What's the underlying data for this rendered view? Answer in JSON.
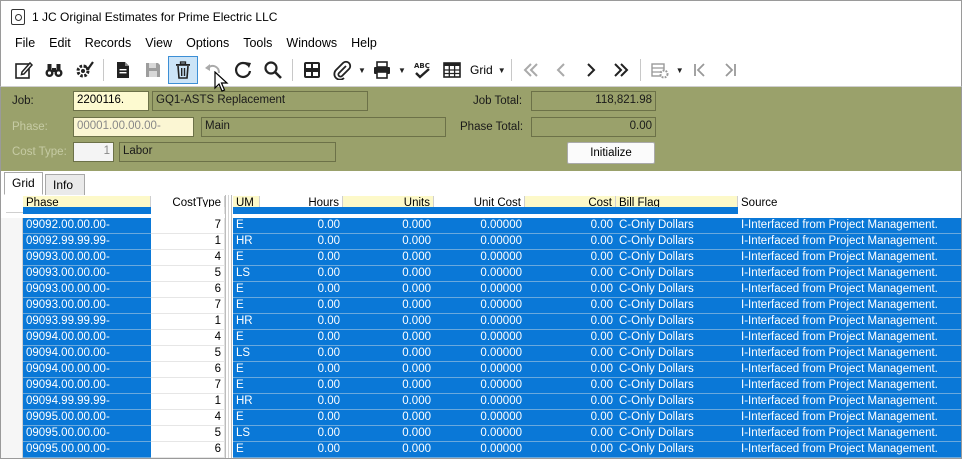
{
  "window": {
    "title": "1 JC Original Estimates for Prime Electric LLC"
  },
  "menu": [
    "File",
    "Edit",
    "Records",
    "View",
    "Options",
    "Tools",
    "Windows",
    "Help"
  ],
  "toolbar": {
    "grid_label": "Grid",
    "icons": [
      "edit-icon",
      "binoculars-icon",
      "settings-check-icon",
      "document-icon",
      "save-icon",
      "delete-icon",
      "undo-icon",
      "refresh-icon",
      "search-icon",
      "columns-icon",
      "attachment-icon",
      "print-icon",
      "spellcheck-icon",
      "grid-icon",
      "first-record-icon",
      "previous-record-icon",
      "next-record-icon",
      "last-record-icon",
      "settings-icon",
      "first-icon",
      "last-icon"
    ]
  },
  "header": {
    "job_label": "Job:",
    "job_value": "2200116.",
    "job_desc": "GQ1-ASTS Replacement",
    "phase_label": "Phase:",
    "phase_value": "00001.00.00.00-",
    "phase_desc": "Main",
    "costtype_label": "Cost Type:",
    "costtype_value": "1",
    "costtype_desc": "Labor",
    "job_total_label": "Job Total:",
    "job_total_value": "118,821.98",
    "phase_total_label": "Phase Total:",
    "phase_total_value": "0.00",
    "initialize_label": "Initialize"
  },
  "tabs": [
    "Grid",
    "Info"
  ],
  "grid": {
    "columns": {
      "phase": "Phase",
      "costtype": "CostType",
      "um": "UM",
      "hours": "Hours",
      "units": "Units",
      "unit_cost": "Unit Cost",
      "cost": "Cost",
      "bill_flag": "Bill Flag",
      "source": "Source"
    },
    "rows": [
      {
        "phase": "09092.00.00.00-",
        "costtype": "7",
        "um": "E",
        "hours": "0.00",
        "units": "0.000",
        "unit_cost": "0.00000",
        "cost": "0.00",
        "bill_flag": "C-Only Dollars",
        "source": "I-Interfaced from Project Management."
      },
      {
        "phase": "09092.99.99.99-",
        "costtype": "1",
        "um": "HR",
        "hours": "0.00",
        "units": "0.000",
        "unit_cost": "0.00000",
        "cost": "0.00",
        "bill_flag": "C-Only Dollars",
        "source": "I-Interfaced from Project Management."
      },
      {
        "phase": "09093.00.00.00-",
        "costtype": "4",
        "um": "E",
        "hours": "0.00",
        "units": "0.000",
        "unit_cost": "0.00000",
        "cost": "0.00",
        "bill_flag": "C-Only Dollars",
        "source": "I-Interfaced from Project Management."
      },
      {
        "phase": "09093.00.00.00-",
        "costtype": "5",
        "um": "LS",
        "hours": "0.00",
        "units": "0.000",
        "unit_cost": "0.00000",
        "cost": "0.00",
        "bill_flag": "C-Only Dollars",
        "source": "I-Interfaced from Project Management."
      },
      {
        "phase": "09093.00.00.00-",
        "costtype": "6",
        "um": "E",
        "hours": "0.00",
        "units": "0.000",
        "unit_cost": "0.00000",
        "cost": "0.00",
        "bill_flag": "C-Only Dollars",
        "source": "I-Interfaced from Project Management."
      },
      {
        "phase": "09093.00.00.00-",
        "costtype": "7",
        "um": "E",
        "hours": "0.00",
        "units": "0.000",
        "unit_cost": "0.00000",
        "cost": "0.00",
        "bill_flag": "C-Only Dollars",
        "source": "I-Interfaced from Project Management."
      },
      {
        "phase": "09093.99.99.99-",
        "costtype": "1",
        "um": "HR",
        "hours": "0.00",
        "units": "0.000",
        "unit_cost": "0.00000",
        "cost": "0.00",
        "bill_flag": "C-Only Dollars",
        "source": "I-Interfaced from Project Management."
      },
      {
        "phase": "09094.00.00.00-",
        "costtype": "4",
        "um": "E",
        "hours": "0.00",
        "units": "0.000",
        "unit_cost": "0.00000",
        "cost": "0.00",
        "bill_flag": "C-Only Dollars",
        "source": "I-Interfaced from Project Management."
      },
      {
        "phase": "09094.00.00.00-",
        "costtype": "5",
        "um": "LS",
        "hours": "0.00",
        "units": "0.000",
        "unit_cost": "0.00000",
        "cost": "0.00",
        "bill_flag": "C-Only Dollars",
        "source": "I-Interfaced from Project Management."
      },
      {
        "phase": "09094.00.00.00-",
        "costtype": "6",
        "um": "E",
        "hours": "0.00",
        "units": "0.000",
        "unit_cost": "0.00000",
        "cost": "0.00",
        "bill_flag": "C-Only Dollars",
        "source": "I-Interfaced from Project Management."
      },
      {
        "phase": "09094.00.00.00-",
        "costtype": "7",
        "um": "E",
        "hours": "0.00",
        "units": "0.000",
        "unit_cost": "0.00000",
        "cost": "0.00",
        "bill_flag": "C-Only Dollars",
        "source": "I-Interfaced from Project Management."
      },
      {
        "phase": "09094.99.99.99-",
        "costtype": "1",
        "um": "HR",
        "hours": "0.00",
        "units": "0.000",
        "unit_cost": "0.00000",
        "cost": "0.00",
        "bill_flag": "C-Only Dollars",
        "source": "I-Interfaced from Project Management."
      },
      {
        "phase": "09095.00.00.00-",
        "costtype": "4",
        "um": "E",
        "hours": "0.00",
        "units": "0.000",
        "unit_cost": "0.00000",
        "cost": "0.00",
        "bill_flag": "C-Only Dollars",
        "source": "I-Interfaced from Project Management."
      },
      {
        "phase": "09095.00.00.00-",
        "costtype": "5",
        "um": "LS",
        "hours": "0.00",
        "units": "0.000",
        "unit_cost": "0.00000",
        "cost": "0.00",
        "bill_flag": "C-Only Dollars",
        "source": "I-Interfaced from Project Management."
      },
      {
        "phase": "09095.00.00.00-",
        "costtype": "6",
        "um": "E",
        "hours": "0.00",
        "units": "0.000",
        "unit_cost": "0.00000",
        "cost": "0.00",
        "bill_flag": "C-Only Dollars",
        "source": "I-Interfaced from Project Management."
      }
    ]
  },
  "colors": {
    "selection": "#0a78d7",
    "header_panel": "#9aa16b",
    "header_yellow": "#fdf9c9"
  }
}
